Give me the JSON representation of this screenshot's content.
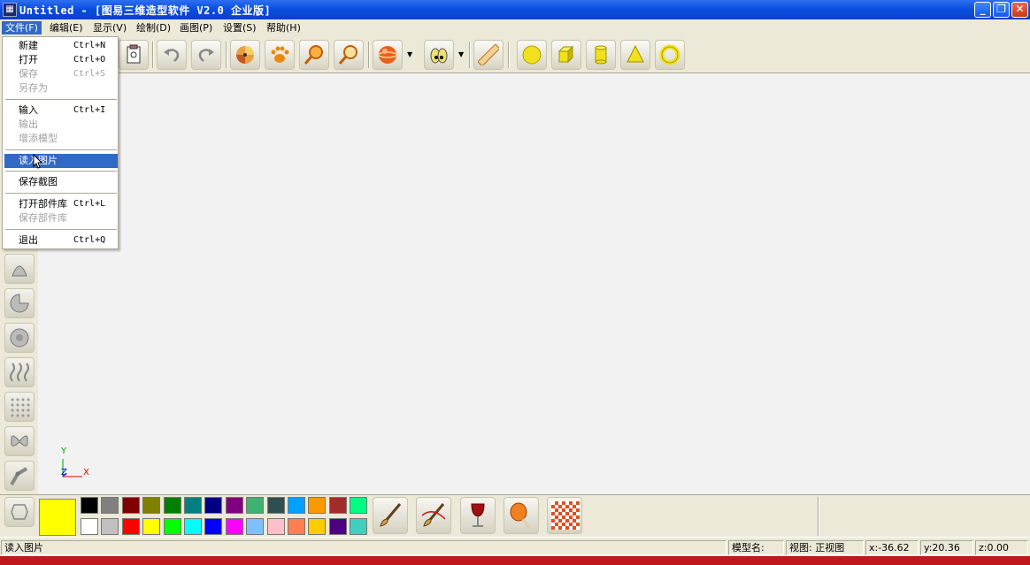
{
  "window": {
    "title": "Untitled - [图易三维造型软件 V2.0 企业版]",
    "min_glyph": "_",
    "max_glyph": "❐",
    "close_glyph": "✕"
  },
  "menubar": [
    "文件(F)",
    "编辑(E)",
    "显示(V)",
    "绘制(D)",
    "画图(P)",
    "设置(S)",
    "帮助(H)"
  ],
  "file_menu": [
    {
      "label": "新建",
      "shortcut": "Ctrl+N",
      "disabled": false
    },
    {
      "label": "打开",
      "shortcut": "Ctrl+O",
      "disabled": false
    },
    {
      "label": "保存",
      "shortcut": "Ctrl+S",
      "disabled": true
    },
    {
      "label": "另存为",
      "shortcut": "",
      "disabled": true
    },
    {
      "label": "输入",
      "shortcut": "Ctrl+I",
      "disabled": false
    },
    {
      "label": "输出",
      "shortcut": "",
      "disabled": true
    },
    {
      "label": "增添模型",
      "shortcut": "",
      "disabled": true
    },
    {
      "label": "读入图片",
      "shortcut": "",
      "disabled": false,
      "highlighted": true
    },
    {
      "label": "保存截图",
      "shortcut": "",
      "disabled": false
    },
    {
      "label": "打开部件库",
      "shortcut": "Ctrl+L",
      "disabled": false
    },
    {
      "label": "保存部件库",
      "shortcut": "",
      "disabled": true
    },
    {
      "label": "退出",
      "shortcut": "Ctrl+Q",
      "disabled": false
    }
  ],
  "toolbar_icons": [
    "clipboard-icon",
    "undo-icon",
    "redo-icon",
    "pinwheel-icon",
    "paw-icon",
    "zoom-in-icon",
    "zoom-out-icon",
    "sphere-view-icon",
    "eyes-icon",
    "ruler-icon",
    "sphere-icon",
    "cube-icon",
    "cylinder-icon",
    "cone-icon",
    "torus-icon"
  ],
  "left_tools": [
    "lathe-icon",
    "pie-icon",
    "disc-icon",
    "spring-icon",
    "mesh-icon",
    "butterfly-icon",
    "arm-icon",
    "lasso-icon"
  ],
  "canvas": {
    "axis_y": "Y",
    "axis_z": "Z",
    "axis_x": "X",
    "background": "#f2f2f2"
  },
  "palette": {
    "current": "#ffff00",
    "row1": [
      "#000000",
      "#808080",
      "#800000",
      "#808000",
      "#008000",
      "#008080",
      "#000080",
      "#800080",
      "#3cb371",
      "#2f4f4f",
      "#00a0ff",
      "#ff9900",
      "#a52a2a",
      "#00ff80"
    ],
    "row2": [
      "#ffffff",
      "#c0c0c0",
      "#ff0000",
      "#ffff00",
      "#00ff00",
      "#00ffff",
      "#0000ff",
      "#ff00ff",
      "#80c0ff",
      "#ffc0cb",
      "#ff7f50",
      "#ffcc00",
      "#4b0082",
      "#40d0c0"
    ],
    "tools": [
      "brush-icon",
      "brush-curve-icon",
      "wine-glass-icon",
      "drumstick-icon",
      "checker-texture-icon"
    ]
  },
  "status": {
    "message": "读入图片",
    "model_name_label": "模型名:",
    "view": "视图: 正视图",
    "x": "x:-36.62",
    "y": "y:20.36",
    "z": "z:0.00"
  }
}
